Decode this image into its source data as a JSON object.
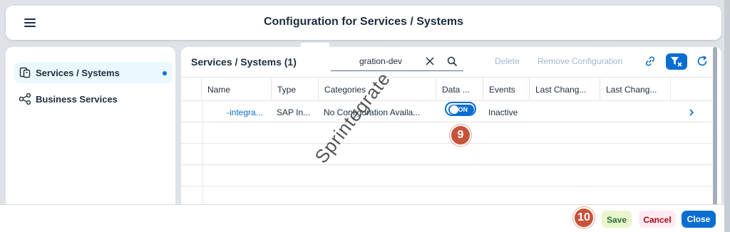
{
  "header": {
    "title": "Configuration for Services / Systems"
  },
  "sidebar": {
    "items": [
      {
        "label": "Services / Systems",
        "icon": "services-systems-icon",
        "active": true
      },
      {
        "label": "Business Services",
        "icon": "share-nodes-icon",
        "active": false
      }
    ]
  },
  "toolbar": {
    "table_title": "Services / Systems (1)",
    "search_value": "gration-dev",
    "delete_label": "Delete",
    "remove_label": "Remove Configuration"
  },
  "table": {
    "columns": [
      "Name",
      "Type",
      "Categories",
      "Data ...",
      "Events",
      "Last Chang...",
      "Last Chang..."
    ],
    "rows": [
      {
        "name": "-integra...",
        "type": "SAP In...",
        "categories": "No Configuration Availa...",
        "data_toggle": "ON",
        "events": "Inactive",
        "last_changed_1": "",
        "last_changed_2": ""
      }
    ]
  },
  "steps": {
    "step_9": "9",
    "step_10": "10"
  },
  "footer": {
    "save_label": "Save",
    "cancel_label": "Cancel",
    "close_label": "Close"
  },
  "watermark": "Sprintegrate",
  "colors": {
    "accent": "#0a6ed1",
    "badge": "#c9533a",
    "save_bg": "#ebf5cb",
    "cancel_bg": "#ffeaf4"
  }
}
